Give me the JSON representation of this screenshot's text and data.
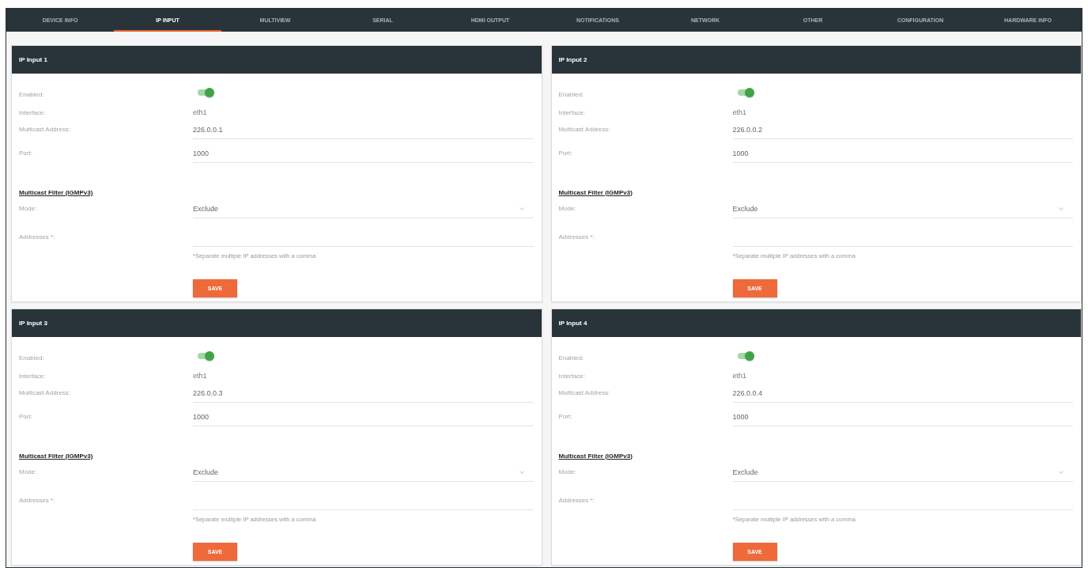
{
  "tabs": [
    {
      "label": "DEVICE INFO",
      "selected": false
    },
    {
      "label": "IP INPUT",
      "selected": true
    },
    {
      "label": "MULTIVIEW",
      "selected": false
    },
    {
      "label": "SERIAL",
      "selected": false
    },
    {
      "label": "HDMI OUTPUT",
      "selected": false
    },
    {
      "label": "NOTIFICATIONS",
      "selected": false
    },
    {
      "label": "NETWORK",
      "selected": false
    },
    {
      "label": "OTHER",
      "selected": false
    },
    {
      "label": "CONFIGURATION",
      "selected": false
    },
    {
      "label": "HARDWARE INFO",
      "selected": false
    }
  ],
  "panels": [
    {
      "title": "IP Input 1",
      "rows": [
        {
          "kind": "toggle",
          "label": "Enabled:",
          "on": true
        },
        {
          "kind": "static",
          "label": "Interface:",
          "value": "eth1"
        },
        {
          "kind": "input",
          "label": "Multicast Address:",
          "value": "226.0.0.1"
        },
        {
          "kind": "input",
          "label": "Port:",
          "value": "1000"
        },
        {
          "kind": "section",
          "label": "Multicast Filter (IGMPv3)"
        },
        {
          "kind": "select",
          "label": "Mode:",
          "value": "Exclude"
        },
        {
          "kind": "input",
          "label": "Addresses *:",
          "hint": "*Separate multiple IP addresses with a comma"
        }
      ],
      "button": "SAVE"
    },
    {
      "title": "IP Input 2",
      "rows": [
        {
          "kind": "toggle",
          "label": "Enabled:",
          "on": true
        },
        {
          "kind": "static",
          "label": "Interface:",
          "value": "eth1"
        },
        {
          "kind": "input",
          "label": "Multicast Address:",
          "value": "226.0.0.2"
        },
        {
          "kind": "input",
          "label": "Port:",
          "value": "1000"
        },
        {
          "kind": "section",
          "label": "Multicast Filter (IGMPv3)"
        },
        {
          "kind": "select",
          "label": "Mode:",
          "value": "Exclude"
        },
        {
          "kind": "input",
          "label": "Addresses *:",
          "hint": "*Separate multiple IP addresses with a comma"
        }
      ],
      "button": "SAVE"
    },
    {
      "title": "IP Input 3",
      "rows": [
        {
          "kind": "toggle",
          "label": "Enabled:",
          "on": true
        },
        {
          "kind": "static",
          "label": "Interface:",
          "value": "eth1"
        },
        {
          "kind": "input",
          "label": "Multicast Address:",
          "value": "226.0.0.3"
        },
        {
          "kind": "input",
          "label": "Port:",
          "value": "1000"
        },
        {
          "kind": "section",
          "label": "Multicast Filter (IGMPv3)"
        },
        {
          "kind": "select",
          "label": "Mode:",
          "value": "Exclude"
        },
        {
          "kind": "input",
          "label": "Addresses *:",
          "hint": "*Separate multiple IP addresses with a comma"
        }
      ],
      "button": "SAVE"
    },
    {
      "title": "IP Input 4",
      "rows": [
        {
          "kind": "toggle",
          "label": "Enabled:",
          "on": true
        },
        {
          "kind": "static",
          "label": "Interface:",
          "value": "eth1"
        },
        {
          "kind": "input",
          "label": "Multicast Address:",
          "value": "226.0.0.4"
        },
        {
          "kind": "input",
          "label": "Port:",
          "value": "1000"
        },
        {
          "kind": "section",
          "label": "Multicast Filter (IGMPv3)"
        },
        {
          "kind": "select",
          "label": "Mode:",
          "value": "Exclude"
        },
        {
          "kind": "input",
          "label": "Addresses *:",
          "hint": "*Separate multiple IP addresses with a comma"
        }
      ],
      "button": "SAVE"
    }
  ]
}
